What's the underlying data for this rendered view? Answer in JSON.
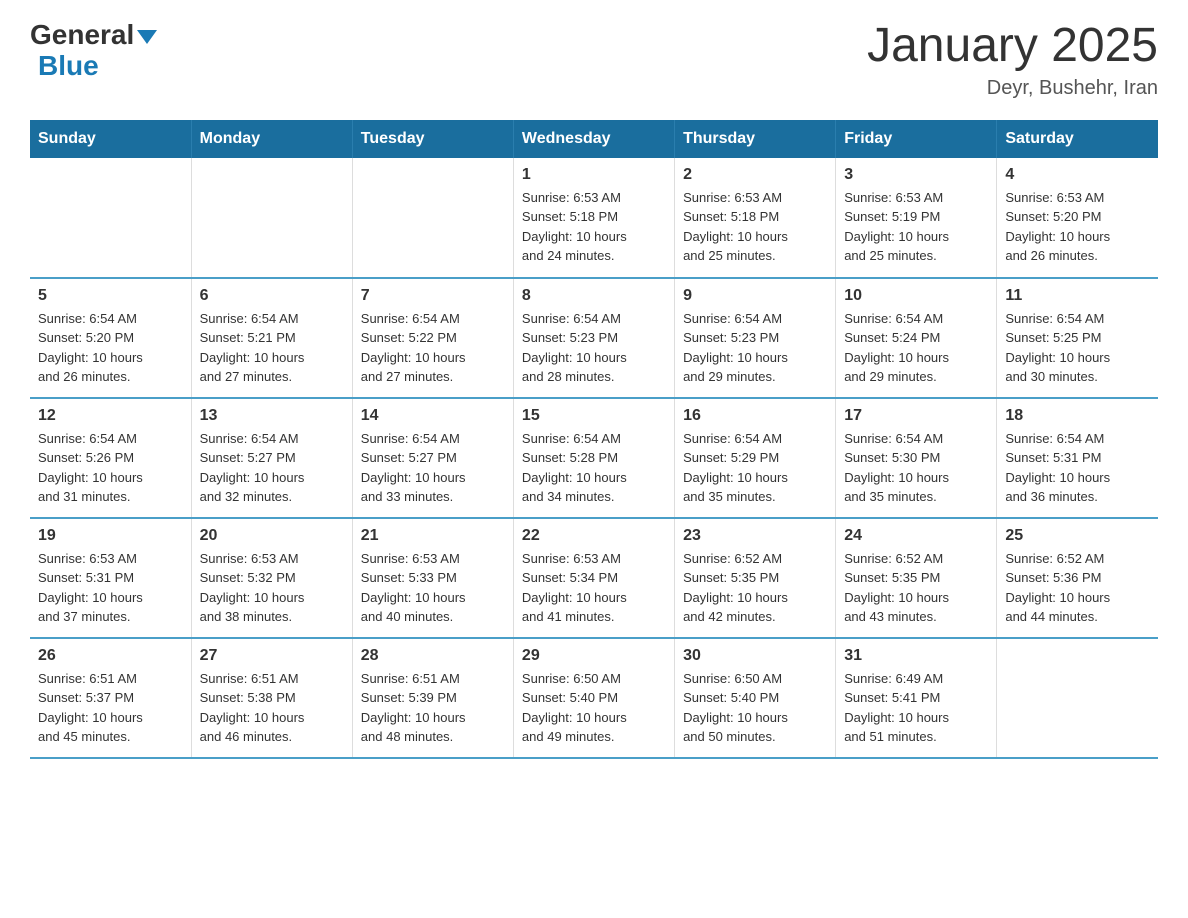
{
  "header": {
    "logo_general": "General",
    "logo_blue": "Blue",
    "title": "January 2025",
    "subtitle": "Deyr, Bushehr, Iran"
  },
  "days_of_week": [
    "Sunday",
    "Monday",
    "Tuesday",
    "Wednesday",
    "Thursday",
    "Friday",
    "Saturday"
  ],
  "weeks": [
    [
      {
        "day": "",
        "info": ""
      },
      {
        "day": "",
        "info": ""
      },
      {
        "day": "",
        "info": ""
      },
      {
        "day": "1",
        "info": "Sunrise: 6:53 AM\nSunset: 5:18 PM\nDaylight: 10 hours\nand 24 minutes."
      },
      {
        "day": "2",
        "info": "Sunrise: 6:53 AM\nSunset: 5:18 PM\nDaylight: 10 hours\nand 25 minutes."
      },
      {
        "day": "3",
        "info": "Sunrise: 6:53 AM\nSunset: 5:19 PM\nDaylight: 10 hours\nand 25 minutes."
      },
      {
        "day": "4",
        "info": "Sunrise: 6:53 AM\nSunset: 5:20 PM\nDaylight: 10 hours\nand 26 minutes."
      }
    ],
    [
      {
        "day": "5",
        "info": "Sunrise: 6:54 AM\nSunset: 5:20 PM\nDaylight: 10 hours\nand 26 minutes."
      },
      {
        "day": "6",
        "info": "Sunrise: 6:54 AM\nSunset: 5:21 PM\nDaylight: 10 hours\nand 27 minutes."
      },
      {
        "day": "7",
        "info": "Sunrise: 6:54 AM\nSunset: 5:22 PM\nDaylight: 10 hours\nand 27 minutes."
      },
      {
        "day": "8",
        "info": "Sunrise: 6:54 AM\nSunset: 5:23 PM\nDaylight: 10 hours\nand 28 minutes."
      },
      {
        "day": "9",
        "info": "Sunrise: 6:54 AM\nSunset: 5:23 PM\nDaylight: 10 hours\nand 29 minutes."
      },
      {
        "day": "10",
        "info": "Sunrise: 6:54 AM\nSunset: 5:24 PM\nDaylight: 10 hours\nand 29 minutes."
      },
      {
        "day": "11",
        "info": "Sunrise: 6:54 AM\nSunset: 5:25 PM\nDaylight: 10 hours\nand 30 minutes."
      }
    ],
    [
      {
        "day": "12",
        "info": "Sunrise: 6:54 AM\nSunset: 5:26 PM\nDaylight: 10 hours\nand 31 minutes."
      },
      {
        "day": "13",
        "info": "Sunrise: 6:54 AM\nSunset: 5:27 PM\nDaylight: 10 hours\nand 32 minutes."
      },
      {
        "day": "14",
        "info": "Sunrise: 6:54 AM\nSunset: 5:27 PM\nDaylight: 10 hours\nand 33 minutes."
      },
      {
        "day": "15",
        "info": "Sunrise: 6:54 AM\nSunset: 5:28 PM\nDaylight: 10 hours\nand 34 minutes."
      },
      {
        "day": "16",
        "info": "Sunrise: 6:54 AM\nSunset: 5:29 PM\nDaylight: 10 hours\nand 35 minutes."
      },
      {
        "day": "17",
        "info": "Sunrise: 6:54 AM\nSunset: 5:30 PM\nDaylight: 10 hours\nand 35 minutes."
      },
      {
        "day": "18",
        "info": "Sunrise: 6:54 AM\nSunset: 5:31 PM\nDaylight: 10 hours\nand 36 minutes."
      }
    ],
    [
      {
        "day": "19",
        "info": "Sunrise: 6:53 AM\nSunset: 5:31 PM\nDaylight: 10 hours\nand 37 minutes."
      },
      {
        "day": "20",
        "info": "Sunrise: 6:53 AM\nSunset: 5:32 PM\nDaylight: 10 hours\nand 38 minutes."
      },
      {
        "day": "21",
        "info": "Sunrise: 6:53 AM\nSunset: 5:33 PM\nDaylight: 10 hours\nand 40 minutes."
      },
      {
        "day": "22",
        "info": "Sunrise: 6:53 AM\nSunset: 5:34 PM\nDaylight: 10 hours\nand 41 minutes."
      },
      {
        "day": "23",
        "info": "Sunrise: 6:52 AM\nSunset: 5:35 PM\nDaylight: 10 hours\nand 42 minutes."
      },
      {
        "day": "24",
        "info": "Sunrise: 6:52 AM\nSunset: 5:35 PM\nDaylight: 10 hours\nand 43 minutes."
      },
      {
        "day": "25",
        "info": "Sunrise: 6:52 AM\nSunset: 5:36 PM\nDaylight: 10 hours\nand 44 minutes."
      }
    ],
    [
      {
        "day": "26",
        "info": "Sunrise: 6:51 AM\nSunset: 5:37 PM\nDaylight: 10 hours\nand 45 minutes."
      },
      {
        "day": "27",
        "info": "Sunrise: 6:51 AM\nSunset: 5:38 PM\nDaylight: 10 hours\nand 46 minutes."
      },
      {
        "day": "28",
        "info": "Sunrise: 6:51 AM\nSunset: 5:39 PM\nDaylight: 10 hours\nand 48 minutes."
      },
      {
        "day": "29",
        "info": "Sunrise: 6:50 AM\nSunset: 5:40 PM\nDaylight: 10 hours\nand 49 minutes."
      },
      {
        "day": "30",
        "info": "Sunrise: 6:50 AM\nSunset: 5:40 PM\nDaylight: 10 hours\nand 50 minutes."
      },
      {
        "day": "31",
        "info": "Sunrise: 6:49 AM\nSunset: 5:41 PM\nDaylight: 10 hours\nand 51 minutes."
      },
      {
        "day": "",
        "info": ""
      }
    ]
  ]
}
